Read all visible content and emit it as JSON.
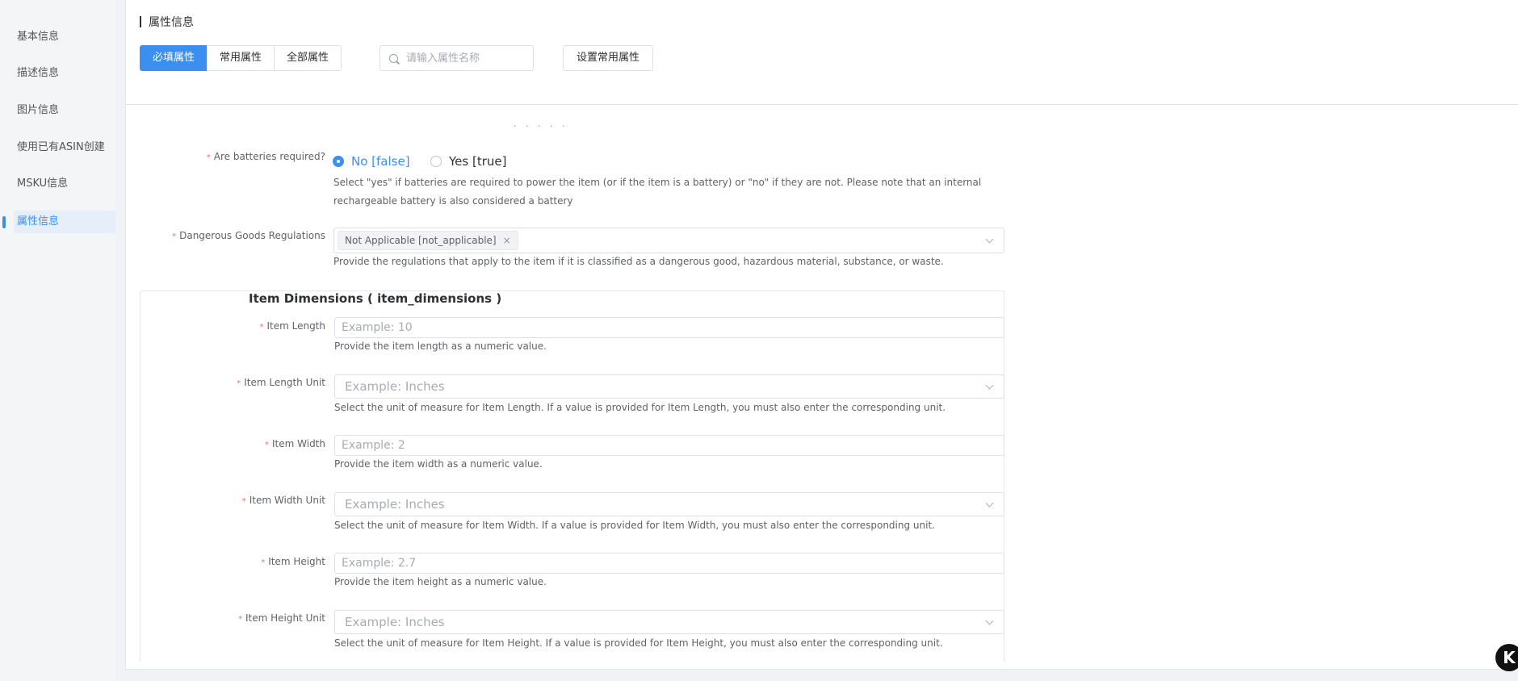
{
  "sidebar": {
    "items": [
      {
        "label": "基本信息"
      },
      {
        "label": "描述信息"
      },
      {
        "label": "图片信息"
      },
      {
        "label": "使用已有ASIN创建"
      },
      {
        "label": "MSKU信息"
      },
      {
        "label": "属性信息",
        "active": true
      }
    ]
  },
  "header": {
    "title": "属性信息",
    "tabs": [
      {
        "label": "必填属性",
        "active": true
      },
      {
        "label": "常用属性"
      },
      {
        "label": "全部属性"
      }
    ],
    "search_placeholder": "请输入属性名称",
    "set_common_label": "设置常用属性"
  },
  "cut_text": "· · · · ·",
  "batteries": {
    "label": "Are batteries required?",
    "options": [
      {
        "label": "No [false]",
        "checked": true
      },
      {
        "label": "Yes [true]",
        "checked": false
      }
    ],
    "hint_line1": "Select \"yes\" if batteries are required to power the item (or if the item is a battery) or \"no\" if they are not. Please note that an internal",
    "hint_line2": "rechargeable battery is also considered a battery"
  },
  "dangerous_goods": {
    "label": "Dangerous Goods Regulations",
    "selected_tag": "Not Applicable [not_applicable]",
    "tag_close": "×",
    "hint": "Provide the regulations that apply to the item if it is classified as a dangerous good, hazardous material, substance, or waste."
  },
  "item_dimensions": {
    "title": "Item Dimensions ( item_dimensions )",
    "fields": [
      {
        "label": "Item Length",
        "placeholder": "Example: 10",
        "hint": "Provide the item length as a numeric value."
      },
      {
        "label": "Item Length Unit",
        "placeholder": "Example: Inches",
        "hint": "Select the unit of measure for Item Length. If a value is provided for Item Length, you must also enter the corresponding unit."
      },
      {
        "label": "Item Width",
        "placeholder": "Example: 2",
        "hint": "Provide the item width as a numeric value."
      },
      {
        "label": "Item Width Unit",
        "placeholder": "Example: Inches",
        "hint": "Select the unit of measure for Item Width. If a value is provided for Item Width, you must also enter the corresponding unit."
      },
      {
        "label": "Item Height",
        "placeholder": "Example: 2.7",
        "hint": "Provide the item height as a numeric value."
      },
      {
        "label": "Item Height Unit",
        "placeholder": "Example: Inches",
        "hint": "Select the unit of measure for Item Height. If a value is provided for Item Height, you must also enter the corresponding unit."
      }
    ]
  },
  "required_mark": "*",
  "badge": "K"
}
